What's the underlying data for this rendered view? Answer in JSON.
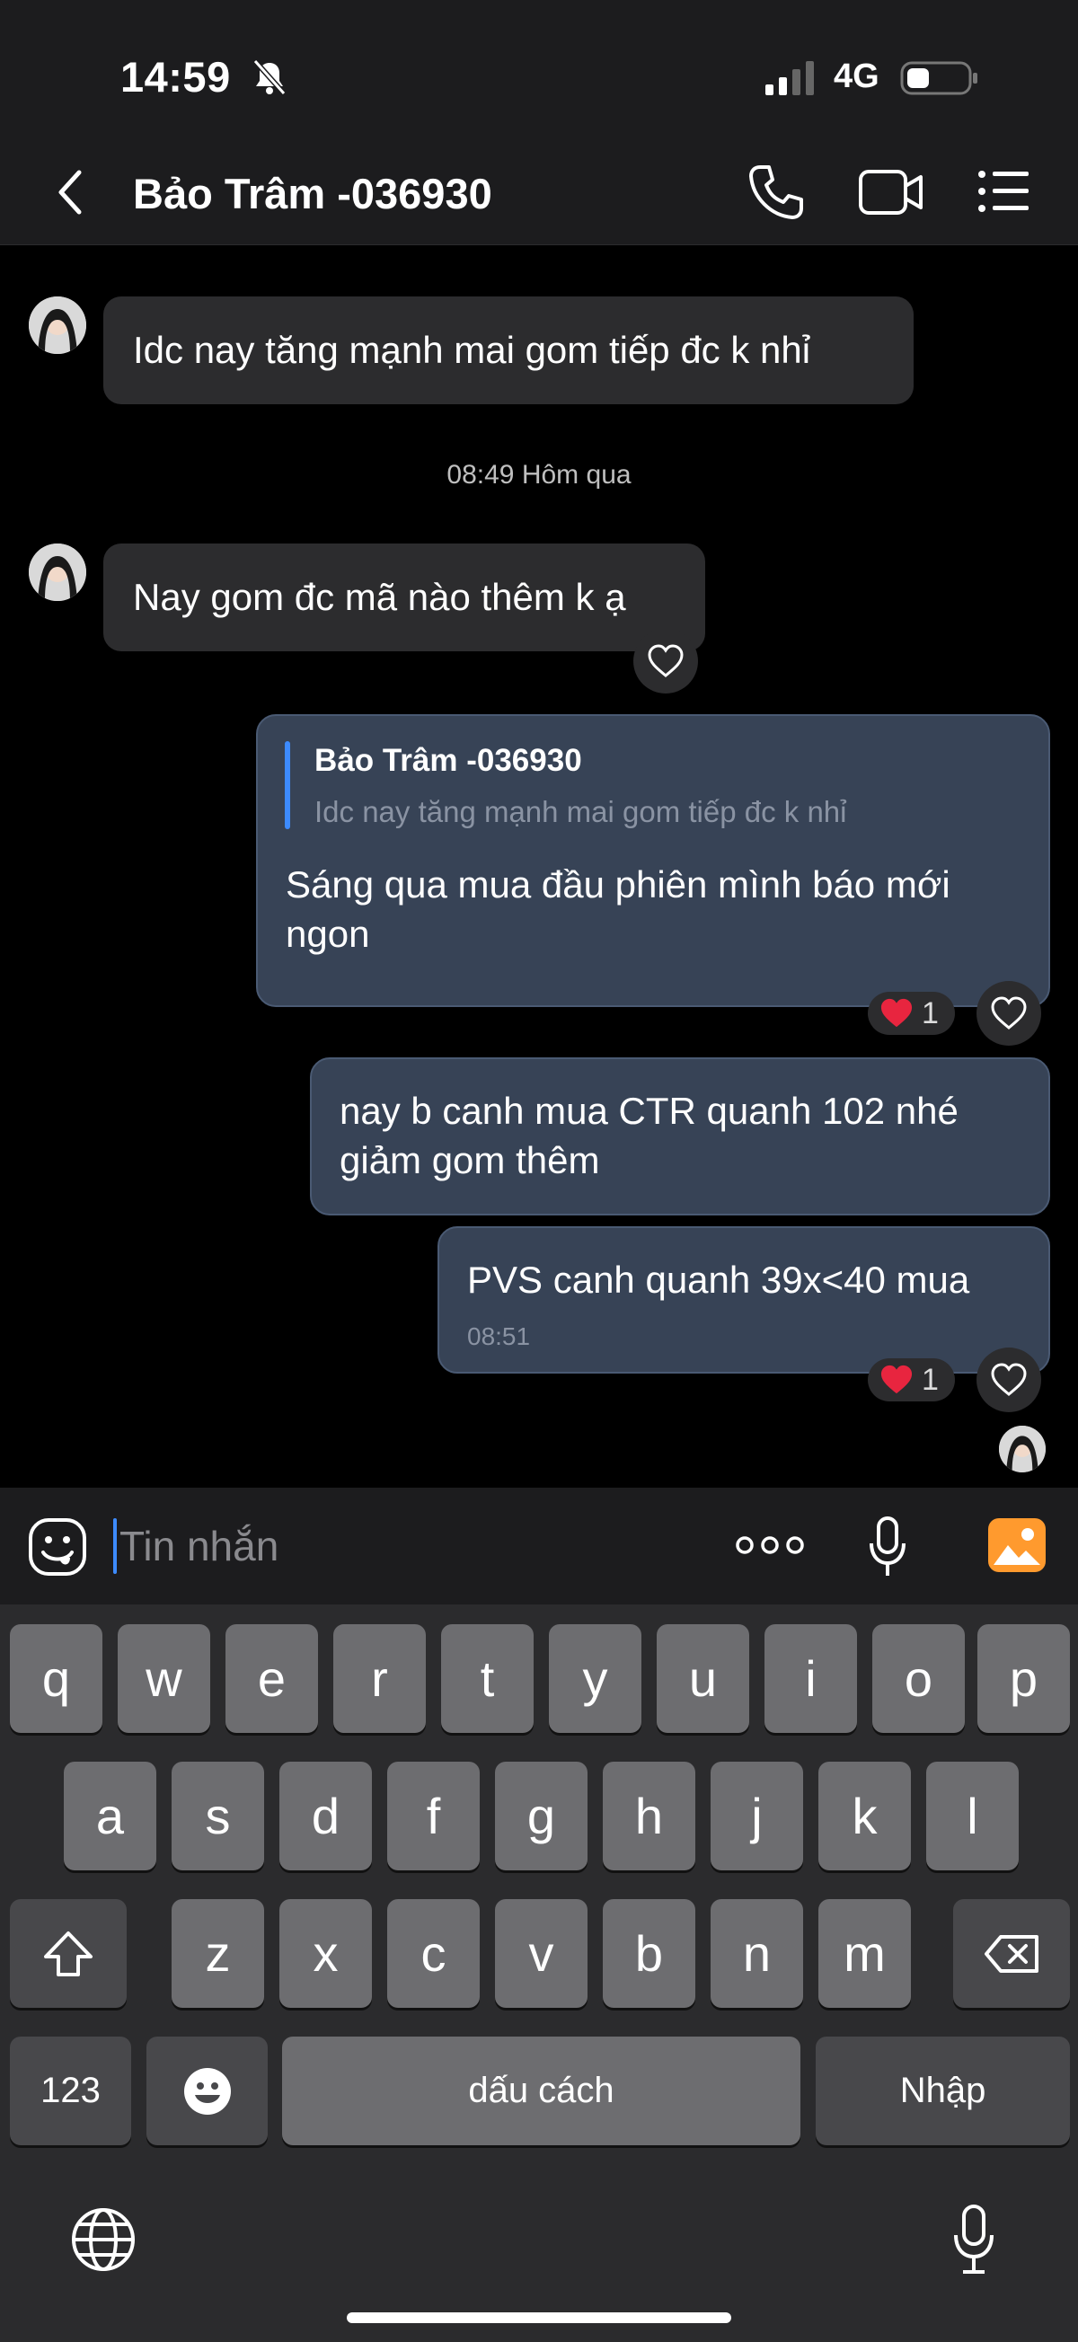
{
  "status_bar": {
    "time": "14:59",
    "network": "4G"
  },
  "header": {
    "contact_name": "Bảo Trâm -036930"
  },
  "messages": [
    {
      "direction": "in",
      "text": "Idc nay tăng mạnh mai gom tiếp đc k nhỉ"
    },
    {
      "separator": "08:49 Hôm qua"
    },
    {
      "direction": "in",
      "text": "Nay gom đc mã nào thêm k ạ"
    },
    {
      "direction": "out",
      "quote": {
        "author": "Bảo Trâm -036930",
        "text": "Idc nay tăng mạnh mai gom tiếp đc k nhỉ"
      },
      "text_line1": "Sáng qua mua đầu phiên mình báo mới",
      "text_line2": "ngon",
      "reaction_count": "1"
    },
    {
      "direction": "out",
      "text_line1": "nay b canh mua CTR quanh 102 nhé",
      "text_line2": "giảm gom thêm"
    },
    {
      "direction": "out",
      "text": "PVS canh quanh 39x<40 mua",
      "time": "08:51",
      "reaction_count": "1"
    }
  ],
  "input": {
    "placeholder": "Tin nhắn"
  },
  "keyboard": {
    "row1": [
      "q",
      "w",
      "e",
      "r",
      "t",
      "y",
      "u",
      "i",
      "o",
      "p"
    ],
    "row2": [
      "a",
      "s",
      "d",
      "f",
      "g",
      "h",
      "j",
      "k",
      "l"
    ],
    "row3": [
      "z",
      "x",
      "c",
      "v",
      "b",
      "n",
      "m"
    ],
    "numbers_key": "123",
    "space_key": "dấu cách",
    "return_key": "Nhập"
  },
  "colors": {
    "outgoing_bubble": "#374356",
    "incoming_bubble": "#2c2c2e",
    "accent": "#3d8bff",
    "heart": "#e8253f",
    "image_icon": "#ff9a2e"
  }
}
